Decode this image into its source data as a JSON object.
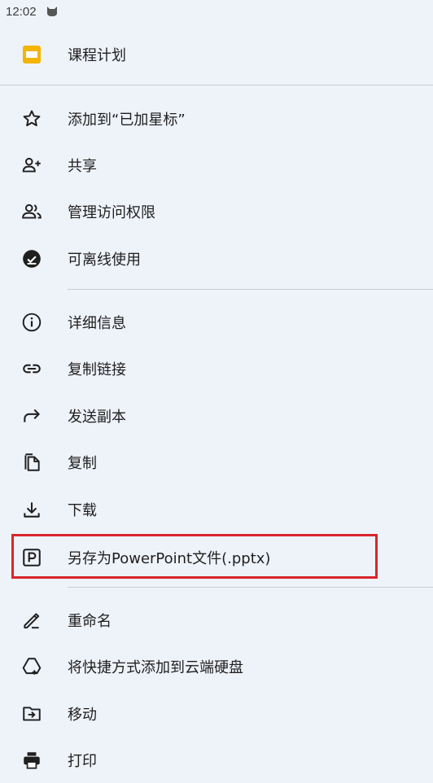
{
  "status_bar": {
    "time": "12:02",
    "notification_icon": "android-cat-icon"
  },
  "header": {
    "title": "课程计划",
    "icon": "slides-file-icon",
    "icon_color": "#f4b400"
  },
  "menu": {
    "section1": [
      {
        "label": "添加到“已加星标”",
        "icon": "star-outline-icon"
      },
      {
        "label": "共享",
        "icon": "person-add-icon"
      },
      {
        "label": "管理访问权限",
        "icon": "people-icon"
      },
      {
        "label": "可离线使用",
        "icon": "offline-check-icon"
      }
    ],
    "section2": [
      {
        "label": "详细信息",
        "icon": "info-icon"
      },
      {
        "label": "复制链接",
        "icon": "link-icon"
      },
      {
        "label": "发送副本",
        "icon": "forward-arrow-icon"
      },
      {
        "label": "复制",
        "icon": "copy-icon"
      },
      {
        "label": "下载",
        "icon": "download-icon"
      },
      {
        "label": "另存为PowerPoint文件(.pptx)",
        "icon": "powerpoint-p-icon"
      }
    ],
    "section3": [
      {
        "label": "重命名",
        "icon": "pencil-icon"
      },
      {
        "label": "将快捷方式添加到云端硬盘",
        "icon": "drive-shortcut-icon"
      },
      {
        "label": "移动",
        "icon": "folder-move-icon"
      },
      {
        "label": "打印",
        "icon": "print-icon"
      }
    ]
  },
  "colors": {
    "background": "#eef2f9",
    "highlight_border": "#d9262c",
    "icon": "#1f1f1f"
  }
}
